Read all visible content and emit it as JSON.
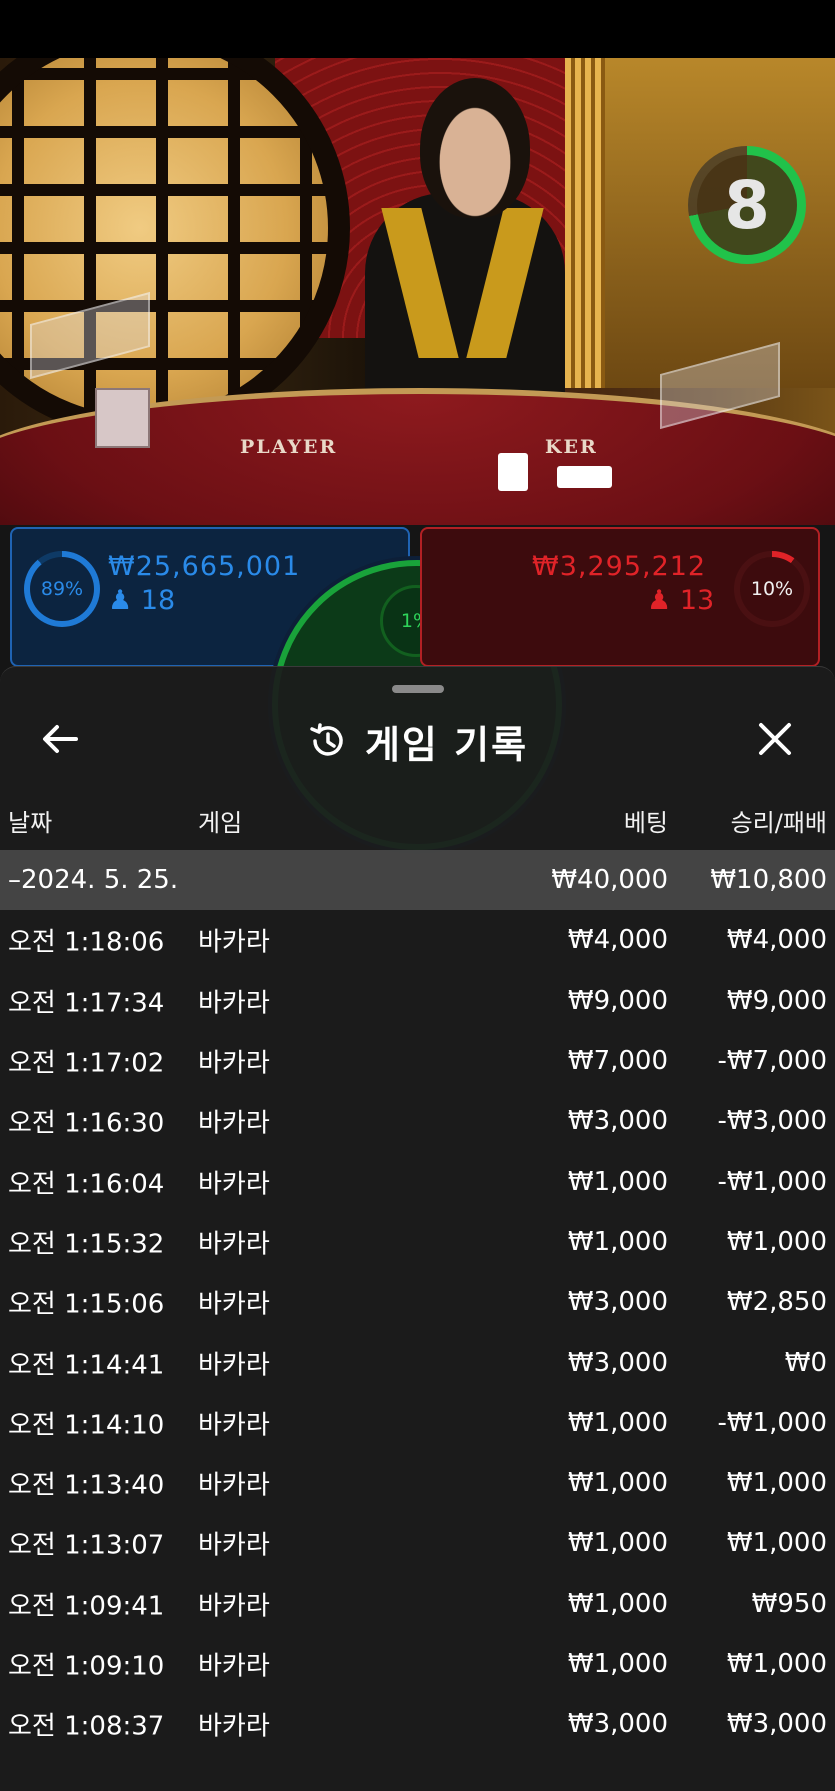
{
  "timer": {
    "count": "8"
  },
  "table_labels": {
    "player": "PLAYER",
    "banker": "KER"
  },
  "player_bet": {
    "percent": "89%",
    "amount": "₩25,665,001",
    "count": "18"
  },
  "banker_bet": {
    "percent": "10%",
    "amount": "₩3,295,212",
    "count": "13"
  },
  "tie_bet": {
    "percent": "1%"
  },
  "sheet": {
    "title": "게임 기록",
    "columns": {
      "date": "날짜",
      "game": "게임",
      "bet": "베팅",
      "result": "승리/패배"
    },
    "summary": {
      "date": "–2024. 5. 25.",
      "bet": "₩40,000",
      "result": "₩10,800"
    },
    "rows": [
      {
        "time": "오전 1:18:06",
        "game": "바카라",
        "bet": "₩4,000",
        "result": "₩4,000"
      },
      {
        "time": "오전 1:17:34",
        "game": "바카라",
        "bet": "₩9,000",
        "result": "₩9,000"
      },
      {
        "time": "오전 1:17:02",
        "game": "바카라",
        "bet": "₩7,000",
        "result": "-₩7,000"
      },
      {
        "time": "오전 1:16:30",
        "game": "바카라",
        "bet": "₩3,000",
        "result": "-₩3,000"
      },
      {
        "time": "오전 1:16:04",
        "game": "바카라",
        "bet": "₩1,000",
        "result": "-₩1,000"
      },
      {
        "time": "오전 1:15:32",
        "game": "바카라",
        "bet": "₩1,000",
        "result": "₩1,000"
      },
      {
        "time": "오전 1:15:06",
        "game": "바카라",
        "bet": "₩3,000",
        "result": "₩2,850"
      },
      {
        "time": "오전 1:14:41",
        "game": "바카라",
        "bet": "₩3,000",
        "result": "₩0"
      },
      {
        "time": "오전 1:14:10",
        "game": "바카라",
        "bet": "₩1,000",
        "result": "-₩1,000"
      },
      {
        "time": "오전 1:13:40",
        "game": "바카라",
        "bet": "₩1,000",
        "result": "₩1,000"
      },
      {
        "time": "오전 1:13:07",
        "game": "바카라",
        "bet": "₩1,000",
        "result": "₩1,000"
      },
      {
        "time": "오전 1:09:41",
        "game": "바카라",
        "bet": "₩1,000",
        "result": "₩950"
      },
      {
        "time": "오전 1:09:10",
        "game": "바카라",
        "bet": "₩1,000",
        "result": "₩1,000"
      },
      {
        "time": "오전 1:08:37",
        "game": "바카라",
        "bet": "₩3,000",
        "result": "₩3,000"
      }
    ]
  },
  "colors": {
    "player": "#1f7ad6",
    "banker": "#e02328",
    "tie": "#21c24a",
    "timer": "#21c24a"
  },
  "icons": {
    "back": "arrow-left-icon",
    "history": "history-icon",
    "close": "close-icon"
  }
}
